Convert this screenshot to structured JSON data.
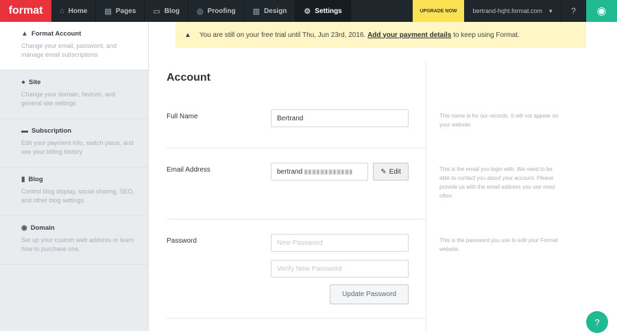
{
  "topbar": {
    "logo": "format",
    "nav": [
      {
        "label": "Home",
        "icon": "home-icon",
        "glyph": "⌂"
      },
      {
        "label": "Pages",
        "icon": "pages-icon",
        "glyph": "▤"
      },
      {
        "label": "Blog",
        "icon": "blog-icon",
        "glyph": "▭"
      },
      {
        "label": "Proofing",
        "icon": "proofing-icon",
        "glyph": "◎"
      },
      {
        "label": "Design",
        "icon": "design-icon",
        "glyph": "▥"
      },
      {
        "label": "Settings",
        "icon": "gear-icon",
        "glyph": "⚙"
      }
    ],
    "upgrade": "UPGRADE NOW",
    "site": "bertrand-hqht.format.com"
  },
  "sidebar": {
    "items": [
      {
        "title": "Format Account",
        "desc": "Change your email, password, and manage email subscriptions",
        "glyph": "👤"
      },
      {
        "title": "Site",
        "desc": "Change your domain, favicon, and general site settings",
        "glyph": "●"
      },
      {
        "title": "Subscription",
        "desc": "Edit your payment info, switch plans, and see your billing history",
        "glyph": "▬"
      },
      {
        "title": "Blog",
        "desc": "Control blog display, social sharing, SEO, and other blog settings.",
        "glyph": "▮"
      },
      {
        "title": "Domain",
        "desc": "Set up your custom web address or learn how to purchase one.",
        "glyph": "◉"
      }
    ]
  },
  "banner": {
    "text": "You are still on your free trial until Thu, Jun 23rd, 2016.",
    "link": "Add your payment details",
    "after": "to keep using Format."
  },
  "account": {
    "title": "Account",
    "full_name": {
      "label": "Full Name",
      "value": "Bertrand",
      "note": "This name is for our records. It will not appear on your website."
    },
    "email": {
      "label": "Email Address",
      "value": "bertrand",
      "edit": "Edit",
      "note": "This is the email you login with. We need to be able to contact you about your account. Please provide us with the email address you use most often."
    },
    "password": {
      "label": "Password",
      "new_placeholder": "New Password",
      "verify_placeholder": "Verify New Password",
      "update": "Update Password",
      "note": "This is the password you use to edit your Format website."
    }
  }
}
